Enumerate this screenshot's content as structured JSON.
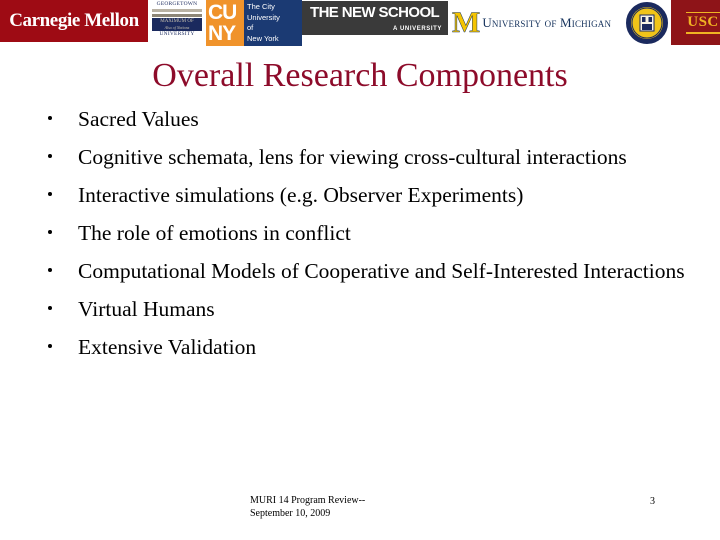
{
  "slide": {
    "title": "Overall Research Components",
    "title_color": "#8d0b2a",
    "background": "#ffffff"
  },
  "logos": {
    "carnegie_mellon": {
      "name": "carnegie-mellon-logo",
      "text": "Carnegie Mellon",
      "bg_color": "#9e0b14",
      "text_color": "#ffffff"
    },
    "georgetown": {
      "name": "georgetown-logo",
      "top_word": "GEORGETOWN",
      "block_line1": "MAXIMUM OF",
      "block_line2": "Also of Nations",
      "bottom_word": "UNIVERSITY",
      "color": "#1b2a5e"
    },
    "cuny": {
      "name": "cuny-logo",
      "mark_line1": "CU",
      "mark_line2": "NY",
      "mark_bg": "#f0932b",
      "words_bg": "#1b3a73",
      "words": "The City University of New York",
      "word_lines": [
        "The City",
        "University",
        "of",
        "New York"
      ]
    },
    "new_school": {
      "name": "new-school-logo",
      "main": "THE NEW SCHOOL",
      "sub": "A UNIVERSITY",
      "bg_color": "#3a3a3a"
    },
    "michigan": {
      "name": "university-of-michigan-logo",
      "mark": "M",
      "text": "University of Michigan",
      "mark_color": "#f5c400",
      "text_color": "#15325c"
    },
    "notre_dame": {
      "name": "notre-dame-seal-logo",
      "ring_color": "#1b2a5e",
      "inner_color": "#f0c419"
    },
    "usc": {
      "name": "usc-logo",
      "text": "USC",
      "bg_color": "#8e1418",
      "text_color": "#f0b323"
    }
  },
  "bullets": [
    {
      "text": "Sacred Values"
    },
    {
      "text": "Cognitive schemata, lens for viewing cross-cultural interactions"
    },
    {
      "text": "Interactive simulations (e.g. Observer Experiments)"
    },
    {
      "text": "The role of emotions in conflict"
    },
    {
      "text": "Computational Models of Cooperative and Self-Interested Interactions"
    },
    {
      "text": "Virtual Humans"
    },
    {
      "text": "Extensive Validation"
    }
  ],
  "footer": {
    "line1": "MURI 14 Program Review--",
    "line2": "September 10, 2009",
    "page_number": "3"
  }
}
